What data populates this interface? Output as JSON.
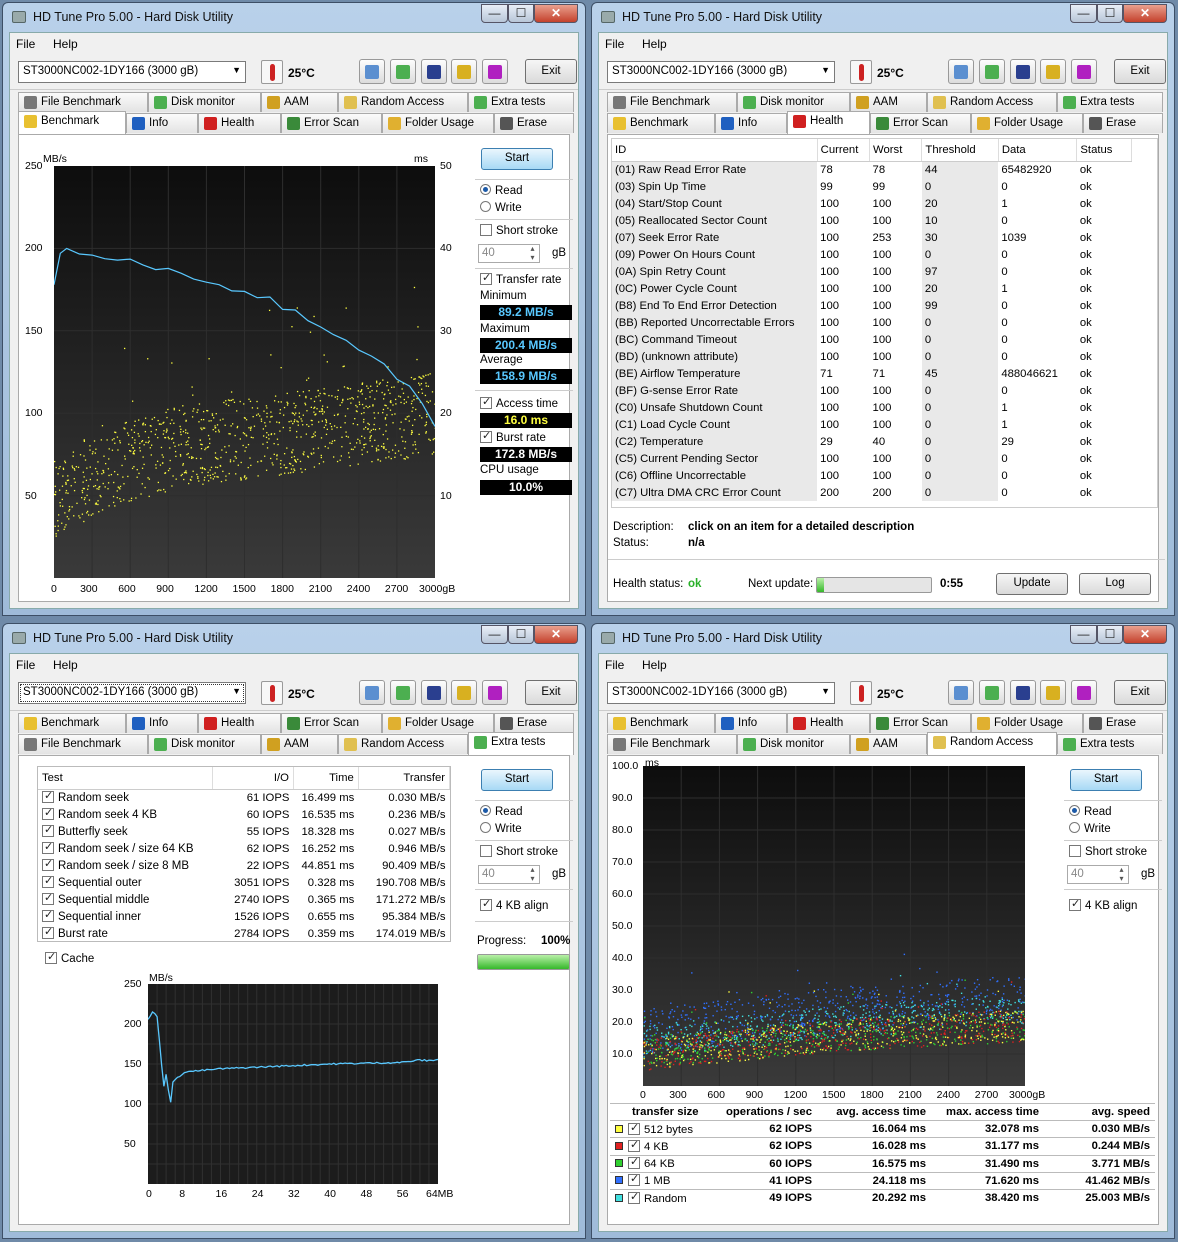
{
  "window_title": "HD Tune Pro 5.00 - Hard Disk Utility",
  "menu": {
    "file": "File",
    "help": "Help"
  },
  "drive": "ST3000NC002-1DY166 (3000 gB)",
  "temperature": "25°C",
  "exit_label": "Exit",
  "window_buttons": {
    "min": "—",
    "max": "☐",
    "close": "✕"
  },
  "tabs": {
    "benchmark": "Benchmark",
    "info": "Info",
    "health": "Health",
    "error_scan": "Error Scan",
    "folder_usage": "Folder Usage",
    "erase": "Erase",
    "file_benchmark": "File Benchmark",
    "disk_monitor": "Disk monitor",
    "aam": "AAM",
    "random_access": "Random Access",
    "extra_tests": "Extra tests"
  },
  "colors": {
    "transfer": "#59c8ff",
    "access": "#ffff40",
    "r512": "#ffff40",
    "r4k": "#e02020",
    "r64k": "#30d030",
    "r1m": "#3070ff",
    "rrand": "#40e0e0"
  },
  "benchmark": {
    "start": "Start",
    "read": "Read",
    "write": "Write",
    "short_stroke": "Short stroke",
    "stroke_val": "40",
    "gb": "gB",
    "transfer_rate": "Transfer rate",
    "minimum": "Minimum",
    "min_val": "89.2 MB/s",
    "maximum": "Maximum",
    "max_val": "200.4 MB/s",
    "average": "Average",
    "avg_val": "158.9 MB/s",
    "access_time": "Access time",
    "access_val": "16.0 ms",
    "burst_rate": "Burst rate",
    "burst_val": "172.8 MB/s",
    "cpu_usage": "CPU usage",
    "cpu_val": "10.0%",
    "y_left_unit": "MB/s",
    "y_right_unit": "ms",
    "y_left_ticks": [
      "250",
      "200",
      "150",
      "100",
      "50"
    ],
    "y_right_ticks": [
      "50",
      "40",
      "30",
      "20",
      "10"
    ],
    "x_ticks": [
      "0",
      "300",
      "600",
      "900",
      "1200",
      "1500",
      "1800",
      "2100",
      "2400",
      "2700",
      "3000gB"
    ]
  },
  "health": {
    "headers": [
      "ID",
      "Current",
      "Worst",
      "Threshold",
      "Data",
      "Status"
    ],
    "rows": [
      [
        "(01) Raw Read Error Rate",
        "78",
        "78",
        "44",
        "65482920",
        "ok"
      ],
      [
        "(03) Spin Up Time",
        "99",
        "99",
        "0",
        "0",
        "ok"
      ],
      [
        "(04) Start/Stop Count",
        "100",
        "100",
        "20",
        "1",
        "ok"
      ],
      [
        "(05) Reallocated Sector Count",
        "100",
        "100",
        "10",
        "0",
        "ok"
      ],
      [
        "(07) Seek Error Rate",
        "100",
        "253",
        "30",
        "1039",
        "ok"
      ],
      [
        "(09) Power On Hours Count",
        "100",
        "100",
        "0",
        "0",
        "ok"
      ],
      [
        "(0A) Spin Retry Count",
        "100",
        "100",
        "97",
        "0",
        "ok"
      ],
      [
        "(0C) Power Cycle Count",
        "100",
        "100",
        "20",
        "1",
        "ok"
      ],
      [
        "(B8) End To End Error Detection",
        "100",
        "100",
        "99",
        "0",
        "ok"
      ],
      [
        "(BB) Reported Uncorrectable Errors",
        "100",
        "100",
        "0",
        "0",
        "ok"
      ],
      [
        "(BC) Command Timeout",
        "100",
        "100",
        "0",
        "0",
        "ok"
      ],
      [
        "(BD) (unknown attribute)",
        "100",
        "100",
        "0",
        "0",
        "ok"
      ],
      [
        "(BE) Airflow Temperature",
        "71",
        "71",
        "45",
        "488046621",
        "ok"
      ],
      [
        "(BF) G-sense Error Rate",
        "100",
        "100",
        "0",
        "0",
        "ok"
      ],
      [
        "(C0) Unsafe Shutdown Count",
        "100",
        "100",
        "0",
        "1",
        "ok"
      ],
      [
        "(C1) Load Cycle Count",
        "100",
        "100",
        "0",
        "1",
        "ok"
      ],
      [
        "(C2) Temperature",
        "29",
        "40",
        "0",
        "29",
        "ok"
      ],
      [
        "(C5) Current Pending Sector",
        "100",
        "100",
        "0",
        "0",
        "ok"
      ],
      [
        "(C6) Offline Uncorrectable",
        "100",
        "100",
        "0",
        "0",
        "ok"
      ],
      [
        "(C7) Ultra DMA CRC Error Count",
        "200",
        "200",
        "0",
        "0",
        "ok"
      ]
    ],
    "description_label": "Description:",
    "description": "click on an item for a detailed description",
    "status_label": "Status:",
    "status": "n/a",
    "health_status_label": "Health status:",
    "health_status": "ok",
    "next_update_label": "Next update:",
    "next_update": "0:55",
    "next_update_progress": 0.06,
    "update": "Update",
    "log": "Log"
  },
  "extra": {
    "headers": [
      "Test",
      "I/O",
      "Time",
      "Transfer"
    ],
    "rows": [
      [
        "Random seek",
        "61 IOPS",
        "16.499 ms",
        "0.030 MB/s"
      ],
      [
        "Random seek 4 KB",
        "60 IOPS",
        "16.535 ms",
        "0.236 MB/s"
      ],
      [
        "Butterfly seek",
        "55 IOPS",
        "18.328 ms",
        "0.027 MB/s"
      ],
      [
        "Random seek / size 64 KB",
        "62 IOPS",
        "16.252 ms",
        "0.946 MB/s"
      ],
      [
        "Random seek / size 8 MB",
        "22 IOPS",
        "44.851 ms",
        "90.409 MB/s"
      ],
      [
        "Sequential outer",
        "3051 IOPS",
        "0.328 ms",
        "190.708 MB/s"
      ],
      [
        "Sequential middle",
        "2740 IOPS",
        "0.365 ms",
        "171.272 MB/s"
      ],
      [
        "Sequential inner",
        "1526 IOPS",
        "0.655 ms",
        "95.384 MB/s"
      ],
      [
        "Burst rate",
        "2784 IOPS",
        "0.359 ms",
        "174.019 MB/s"
      ]
    ],
    "cache": "Cache",
    "start": "Start",
    "read": "Read",
    "write": "Write",
    "short_stroke": "Short stroke",
    "stroke_val": "40",
    "gb": "gB",
    "align": "4 KB align",
    "progress_label": "Progress:",
    "progress": "100%",
    "progress_fraction": 1.0,
    "y_unit": "MB/s",
    "y_ticks": [
      "250",
      "200",
      "150",
      "100",
      "50"
    ],
    "x_ticks": [
      "0",
      "8",
      "16",
      "24",
      "32",
      "40",
      "48",
      "56",
      "64MB"
    ]
  },
  "random": {
    "start": "Start",
    "read": "Read",
    "write": "Write",
    "short_stroke": "Short stroke",
    "stroke_val": "40",
    "gb": "gB",
    "align": "4 KB align",
    "y_unit": "ms",
    "y_ticks": [
      "100.0",
      "90.0",
      "80.0",
      "70.0",
      "60.0",
      "50.0",
      "40.0",
      "30.0",
      "20.0",
      "10.0"
    ],
    "x_ticks": [
      "0",
      "300",
      "600",
      "900",
      "1200",
      "1500",
      "1800",
      "2100",
      "2400",
      "2700",
      "3000gB"
    ],
    "headers": [
      "transfer size",
      "operations / sec",
      "avg. access time",
      "max. access time",
      "avg. speed"
    ],
    "rows": [
      [
        "512 bytes",
        "62 IOPS",
        "16.064 ms",
        "32.078 ms",
        "0.030 MB/s"
      ],
      [
        "4 KB",
        "62 IOPS",
        "16.028 ms",
        "31.177 ms",
        "0.244 MB/s"
      ],
      [
        "64 KB",
        "60 IOPS",
        "16.575 ms",
        "31.490 ms",
        "3.771 MB/s"
      ],
      [
        "1 MB",
        "41 IOPS",
        "24.118 ms",
        "71.620 ms",
        "41.462 MB/s"
      ],
      [
        "Random",
        "49 IOPS",
        "20.292 ms",
        "38.420 ms",
        "25.003 MB/s"
      ]
    ]
  },
  "chart_data": [
    {
      "type": "line",
      "title": "",
      "xlabel": "gB",
      "ylabel": "MB/s",
      "xlim": [
        0,
        3000
      ],
      "ylim": [
        0,
        250
      ],
      "series": [
        {
          "name": "Transfer rate",
          "x": [
            0,
            50,
            100,
            200,
            300,
            400,
            500,
            600,
            700,
            800,
            900,
            1000,
            1100,
            1200,
            1300,
            1400,
            1500,
            1600,
            1700,
            1800,
            1900,
            2000,
            2100,
            2200,
            2300,
            2400,
            2500,
            2600,
            2700,
            2800,
            2900,
            3000
          ],
          "values": [
            178,
            196,
            199,
            198,
            196,
            195,
            193,
            192,
            191,
            189,
            187,
            185,
            183,
            181,
            178,
            176,
            175,
            171,
            169,
            165,
            162,
            158,
            154,
            149,
            145,
            140,
            135,
            129,
            122,
            115,
            107,
            92
          ]
        }
      ]
    },
    {
      "type": "scatter",
      "title": "",
      "xlabel": "gB",
      "ylabel": "ms",
      "xlim": [
        0,
        3000
      ],
      "ylim": [
        0,
        50
      ],
      "series": [
        {
          "name": "Access time",
          "x": [
            0,
            500,
            1000,
            1500,
            2000,
            2500,
            3000
          ],
          "values": [
            10,
            14,
            16,
            17,
            18,
            19,
            20
          ]
        }
      ]
    },
    {
      "type": "line",
      "title": "",
      "xlabel": "MB",
      "ylabel": "MB/s",
      "xlim": [
        0,
        64
      ],
      "ylim": [
        0,
        250
      ],
      "series": [
        {
          "name": "Transfer",
          "x": [
            0,
            1,
            2,
            3,
            3.5,
            4,
            5,
            6,
            8,
            12,
            16,
            24,
            32,
            40,
            48,
            56,
            60,
            62,
            64
          ],
          "values": [
            205,
            215,
            210,
            150,
            120,
            140,
            110,
            130,
            140,
            142,
            144,
            146,
            148,
            150,
            151,
            152,
            155,
            154,
            156
          ]
        }
      ]
    },
    {
      "type": "scatter",
      "title": "",
      "xlabel": "gB",
      "ylabel": "ms",
      "xlim": [
        0,
        3000
      ],
      "ylim": [
        0,
        100
      ],
      "series": [
        {
          "name": "512 bytes",
          "x": [
            0,
            1500,
            3000
          ],
          "values": [
            10,
            16,
            19
          ]
        },
        {
          "name": "4 KB",
          "x": [
            0,
            1500,
            3000
          ],
          "values": [
            10,
            16,
            19
          ]
        },
        {
          "name": "64 KB",
          "x": [
            0,
            1500,
            3000
          ],
          "values": [
            11,
            16,
            19
          ]
        },
        {
          "name": "1 MB",
          "x": [
            0,
            1500,
            3000
          ],
          "values": [
            17,
            24,
            28
          ]
        },
        {
          "name": "Random",
          "x": [
            0,
            1500,
            3000
          ],
          "values": [
            14,
            20,
            24
          ]
        }
      ]
    }
  ]
}
